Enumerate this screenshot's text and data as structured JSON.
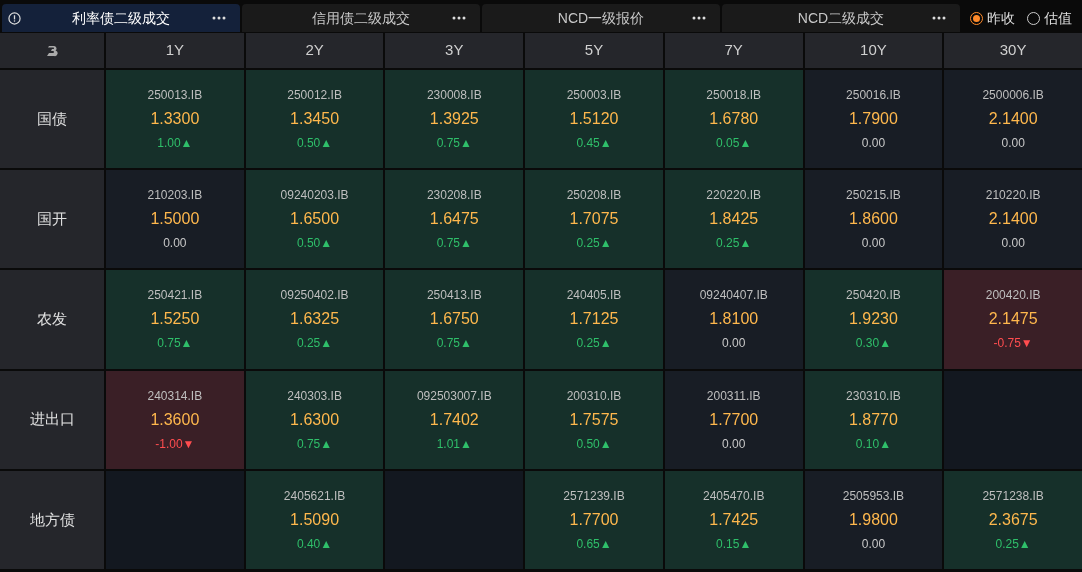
{
  "tabs": [
    {
      "label": "利率债二级成交",
      "selected": true
    },
    {
      "label": "信用债二级成交",
      "selected": false
    },
    {
      "label": "NCD一级报价",
      "selected": false
    },
    {
      "label": "NCD二级成交",
      "selected": false
    }
  ],
  "radios": [
    {
      "label": "昨收",
      "selected": true
    },
    {
      "label": "估值",
      "selected": false
    }
  ],
  "columns": [
    "1Y",
    "2Y",
    "3Y",
    "5Y",
    "7Y",
    "10Y",
    "30Y"
  ],
  "rows": [
    {
      "label": "国债",
      "cells": [
        {
          "kind": "up",
          "code": "250013.IB",
          "price": "1.3300",
          "change": "1.00▲"
        },
        {
          "kind": "up",
          "code": "250012.IB",
          "price": "1.3450",
          "change": "0.50▲"
        },
        {
          "kind": "up",
          "code": "230008.IB",
          "price": "1.3925",
          "change": "0.75▲"
        },
        {
          "kind": "up",
          "code": "250003.IB",
          "price": "1.5120",
          "change": "0.45▲"
        },
        {
          "kind": "up",
          "code": "250018.IB",
          "price": "1.6780",
          "change": "0.05▲"
        },
        {
          "kind": "flat",
          "code": "250016.IB",
          "price": "1.7900",
          "change": "0.00"
        },
        {
          "kind": "flat",
          "code": "2500006.IB",
          "price": "2.1400",
          "change": "0.00"
        }
      ]
    },
    {
      "label": "国开",
      "cells": [
        {
          "kind": "flat",
          "code": "210203.IB",
          "price": "1.5000",
          "change": "0.00"
        },
        {
          "kind": "up",
          "code": "09240203.IB",
          "price": "1.6500",
          "change": "0.50▲"
        },
        {
          "kind": "up",
          "code": "230208.IB",
          "price": "1.6475",
          "change": "0.75▲"
        },
        {
          "kind": "up",
          "code": "250208.IB",
          "price": "1.7075",
          "change": "0.25▲"
        },
        {
          "kind": "up",
          "code": "220220.IB",
          "price": "1.8425",
          "change": "0.25▲"
        },
        {
          "kind": "flat",
          "code": "250215.IB",
          "price": "1.8600",
          "change": "0.00"
        },
        {
          "kind": "flat",
          "code": "210220.IB",
          "price": "2.1400",
          "change": "0.00"
        }
      ]
    },
    {
      "label": "农发",
      "cells": [
        {
          "kind": "up",
          "code": "250421.IB",
          "price": "1.5250",
          "change": "0.75▲"
        },
        {
          "kind": "up",
          "code": "09250402.IB",
          "price": "1.6325",
          "change": "0.25▲"
        },
        {
          "kind": "up",
          "code": "250413.IB",
          "price": "1.6750",
          "change": "0.75▲"
        },
        {
          "kind": "up",
          "code": "240405.IB",
          "price": "1.7125",
          "change": "0.25▲"
        },
        {
          "kind": "flat",
          "code": "09240407.IB",
          "price": "1.8100",
          "change": "0.00"
        },
        {
          "kind": "up",
          "code": "250420.IB",
          "price": "1.9230",
          "change": "0.30▲"
        },
        {
          "kind": "down",
          "code": "200420.IB",
          "price": "2.1475",
          "change": "-0.75▼"
        }
      ]
    },
    {
      "label": "进出口",
      "cells": [
        {
          "kind": "down",
          "code": "240314.IB",
          "price": "1.3600",
          "change": "-1.00▼"
        },
        {
          "kind": "up",
          "code": "240303.IB",
          "price": "1.6300",
          "change": "0.75▲"
        },
        {
          "kind": "up",
          "code": "092503007.IB",
          "price": "1.7402",
          "change": "1.01▲"
        },
        {
          "kind": "up",
          "code": "200310.IB",
          "price": "1.7575",
          "change": "0.50▲"
        },
        {
          "kind": "flat",
          "code": "200311.IB",
          "price": "1.7700",
          "change": "0.00"
        },
        {
          "kind": "up",
          "code": "230310.IB",
          "price": "1.8770",
          "change": "0.10▲"
        },
        {
          "kind": "empty"
        }
      ]
    },
    {
      "label": "地方债",
      "cells": [
        {
          "kind": "empty"
        },
        {
          "kind": "up",
          "code": "2405621.IB",
          "price": "1.5090",
          "change": "0.40▲"
        },
        {
          "kind": "empty"
        },
        {
          "kind": "up",
          "code": "2571239.IB",
          "price": "1.7700",
          "change": "0.65▲"
        },
        {
          "kind": "up",
          "code": "2405470.IB",
          "price": "1.7425",
          "change": "0.15▲"
        },
        {
          "kind": "flat",
          "code": "2505953.IB",
          "price": "1.9800",
          "change": "0.00"
        },
        {
          "kind": "up",
          "code": "2571238.IB",
          "price": "2.3675",
          "change": "0.25▲"
        }
      ]
    }
  ]
}
